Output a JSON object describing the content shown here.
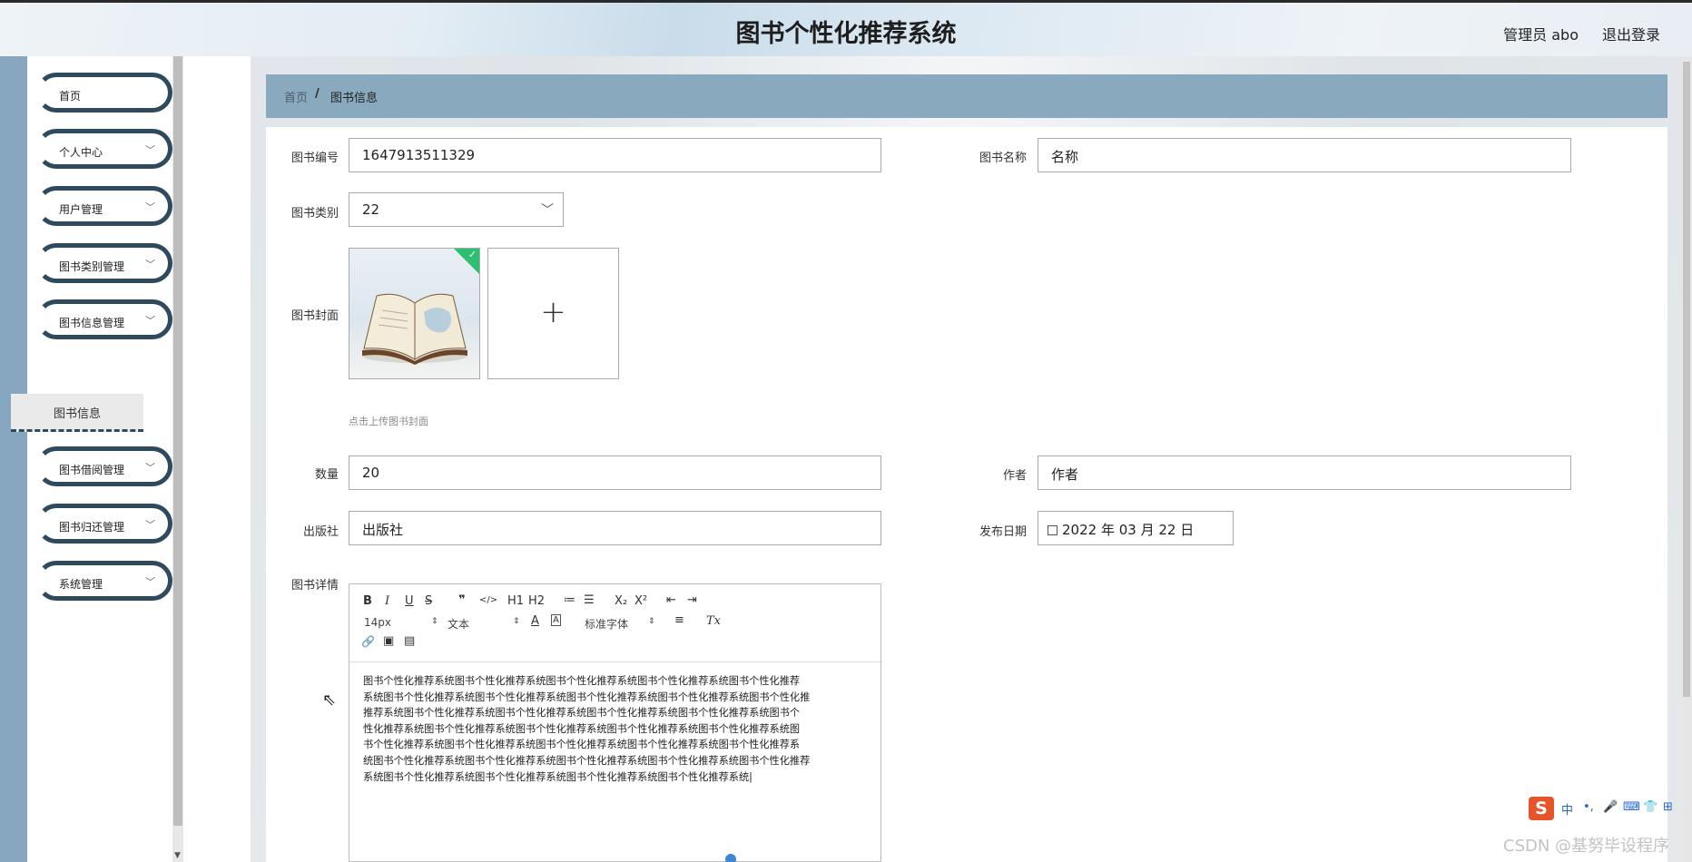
{
  "header": {
    "title": "图书个性化推荐系统",
    "admin_label": "管理员 abo",
    "logout_label": "退出登录"
  },
  "sidebar": {
    "items": [
      {
        "label": "首页",
        "has_chevron": false
      },
      {
        "label": "个人中心",
        "has_chevron": true
      },
      {
        "label": "用户管理",
        "has_chevron": true
      },
      {
        "label": "图书类别管理",
        "has_chevron": true
      },
      {
        "label": "图书信息管理",
        "has_chevron": true
      },
      {
        "label": "图书借阅管理",
        "has_chevron": true
      },
      {
        "label": "图书归还管理",
        "has_chevron": true
      },
      {
        "label": "系统管理",
        "has_chevron": true
      }
    ],
    "active_sub": "图书信息",
    "chevron_icon": "chevron-down-icon",
    "accent_color": "#2d4a5e"
  },
  "breadcrumb": {
    "home": "首页",
    "separator": "/",
    "current": "图书信息"
  },
  "form": {
    "book_no": {
      "label": "图书编号",
      "value": "1647913511329"
    },
    "book_name": {
      "label": "图书名称",
      "value": "名称"
    },
    "category": {
      "label": "图书类别",
      "value": "22"
    },
    "cover": {
      "label": "图书封面",
      "hint": "点击上传图书封面",
      "add_icon": "plus-icon",
      "uploaded_icon": "book-image"
    },
    "quantity": {
      "label": "数量",
      "value": "20"
    },
    "author": {
      "label": "作者",
      "value": "作者"
    },
    "publisher": {
      "label": "出版社",
      "value": "出版社"
    },
    "publish_date": {
      "label": "发布日期",
      "value": "2022 年 03 月 22 日",
      "icon": "calendar-icon"
    },
    "detail": {
      "label": "图书详情"
    }
  },
  "editor": {
    "toolbar": {
      "bold": "B",
      "italic": "I",
      "underline": "U",
      "strike": "S",
      "quote": "❞",
      "code": "</>",
      "h1": "H1",
      "h2": "H2",
      "ordered_list": "≔",
      "bullet_list": "☰",
      "sub": "X₂",
      "sup": "X²",
      "outdent": "⇤",
      "indent": "⇥",
      "size": "14px",
      "header": "文本",
      "font": "标准字体",
      "font_color": "A",
      "bg_color": "A",
      "align": "≡",
      "clean": "Tx",
      "link": "🔗",
      "image": "▣",
      "video": "▤"
    },
    "content_lines": [
      "图书个性化推荐系统图书个性化推荐系统图书个性化推荐系统图书个性化推荐系统图书个性化推荐",
      "系统图书个性化推荐系统图书个性化推荐系统图书个性化推荐系统图书个性化推荐系统图书个性化推",
      "推荐系统图书个性化推荐系统图书个性化推荐系统图书个性化推荐系统图书个性化推荐系统图书个",
      "性化推荐系统图书个性化推荐系统图书个性化推荐系统图书个性化推荐系统图书个性化推荐系统图",
      "书个性化推荐系统图书个性化推荐系统图书个性化推荐系统图书个性化推荐系统图书个性化推荐系",
      "统图书个性化推荐系统图书个性化推荐系统图书个性化推荐系统图书个性化推荐系统图书个性化推荐",
      "系统图书个性化推荐系统图书个性化推荐系统图书个性化推荐系统图书个性化推荐系统|"
    ]
  },
  "ime": {
    "logo": "S",
    "items": [
      "中",
      "•,",
      "🎤",
      "⌨",
      "👕",
      "⊞"
    ]
  },
  "watermark": "CSDN @基努毕设程序",
  "colors": {
    "breadcrumb_bg": "#88a9be",
    "left_strip": "#86a7bf",
    "checkmark": "#2fbf71"
  }
}
